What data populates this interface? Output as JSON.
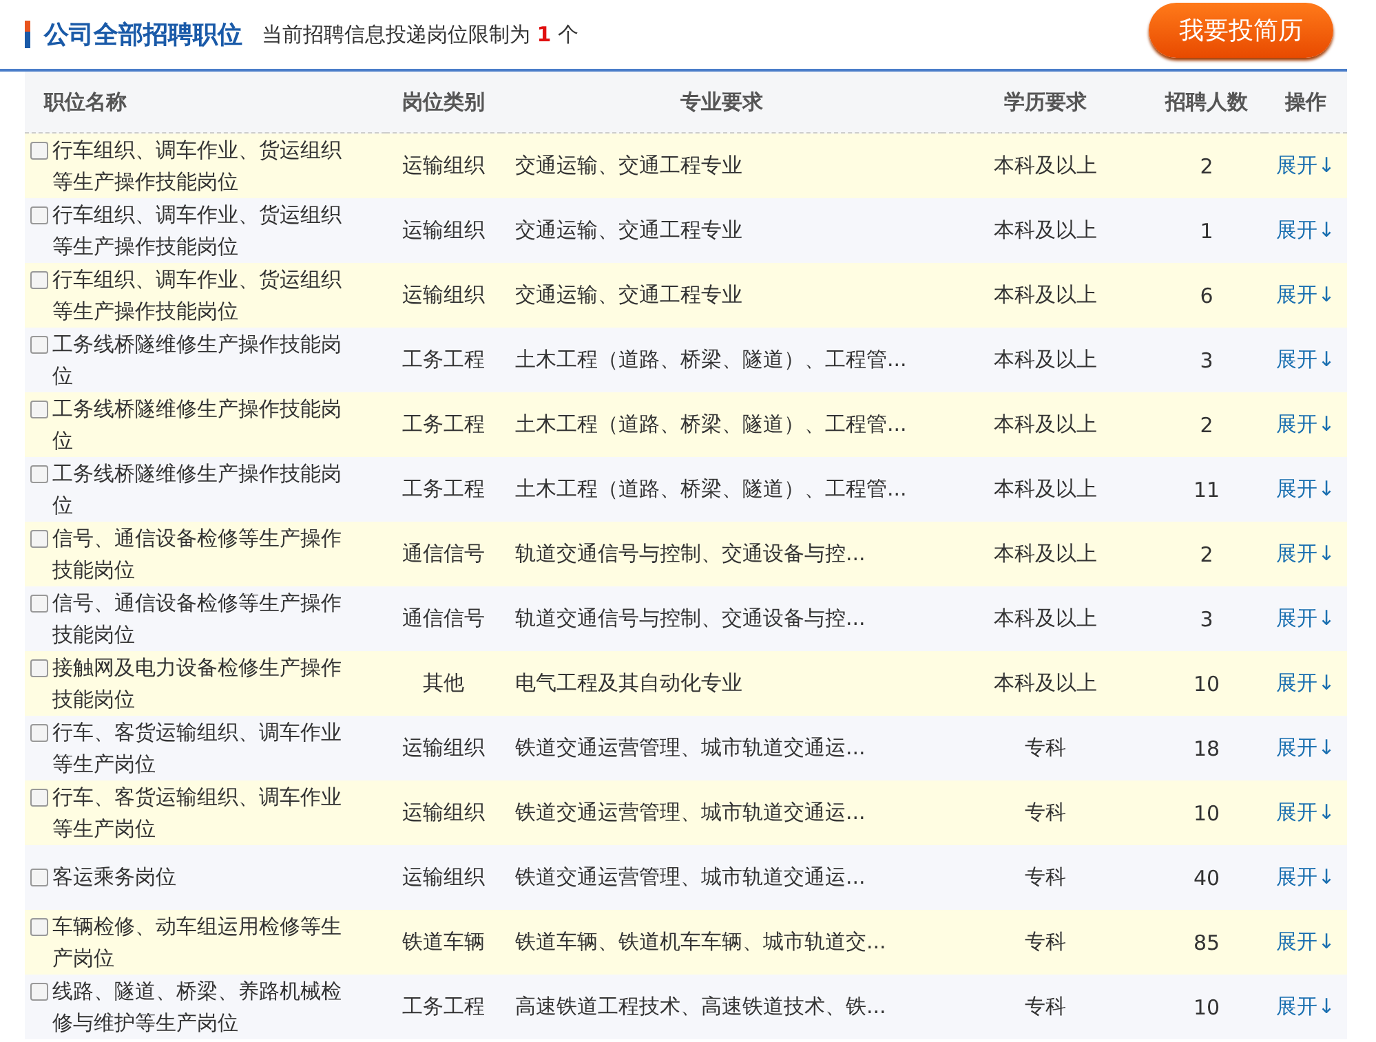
{
  "header": {
    "title": "公司全部招聘职位",
    "limit_text": "当前招聘信息投递岗位限制为",
    "limit_value": "1",
    "limit_unit": "个",
    "apply_button": "我要投简历"
  },
  "table": {
    "columns": [
      "职位名称",
      "岗位类别",
      "专业要求",
      "学历要求",
      "招聘人数",
      "操作"
    ],
    "rows": [
      {
        "checked": false,
        "name": "行车组织、调车作业、货运组织等生产操作技能岗位",
        "category": "运输组织",
        "major": "交通运输、交通工程专业",
        "education": "本科及以上",
        "count": "2",
        "action": "展开↓"
      },
      {
        "checked": false,
        "name": "行车组织、调车作业、货运组织等生产操作技能岗位",
        "category": "运输组织",
        "major": "交通运输、交通工程专业",
        "education": "本科及以上",
        "count": "1",
        "action": "展开↓"
      },
      {
        "checked": false,
        "name": "行车组织、调车作业、货运组织等生产操作技能岗位",
        "category": "运输组织",
        "major": "交通运输、交通工程专业",
        "education": "本科及以上",
        "count": "6",
        "action": "展开↓"
      },
      {
        "checked": false,
        "name": "工务线桥隧维修生产操作技能岗位",
        "category": "工务工程",
        "major": "土木工程（道路、桥梁、隧道）、工程管...",
        "education": "本科及以上",
        "count": "3",
        "action": "展开↓"
      },
      {
        "checked": false,
        "name": "工务线桥隧维修生产操作技能岗位",
        "category": "工务工程",
        "major": "土木工程（道路、桥梁、隧道）、工程管...",
        "education": "本科及以上",
        "count": "2",
        "action": "展开↓"
      },
      {
        "checked": false,
        "name": "工务线桥隧维修生产操作技能岗位",
        "category": "工务工程",
        "major": "土木工程（道路、桥梁、隧道）、工程管...",
        "education": "本科及以上",
        "count": "11",
        "action": "展开↓"
      },
      {
        "checked": false,
        "name": "信号、通信设备检修等生产操作技能岗位",
        "category": "通信信号",
        "major": "轨道交通信号与控制、交通设备与控...",
        "education": "本科及以上",
        "count": "2",
        "action": "展开↓"
      },
      {
        "checked": false,
        "name": "信号、通信设备检修等生产操作技能岗位",
        "category": "通信信号",
        "major": "轨道交通信号与控制、交通设备与控...",
        "education": "本科及以上",
        "count": "3",
        "action": "展开↓"
      },
      {
        "checked": false,
        "name": "接触网及电力设备检修生产操作技能岗位",
        "category": "其他",
        "major": "电气工程及其自动化专业",
        "education": "本科及以上",
        "count": "10",
        "action": "展开↓"
      },
      {
        "checked": false,
        "name": "行车、客货运输组织、调车作业等生产岗位",
        "category": "运输组织",
        "major": "铁道交通运营管理、城市轨道交通运...",
        "education": "专科",
        "count": "18",
        "action": "展开↓"
      },
      {
        "checked": false,
        "name": "行车、客货运输组织、调车作业等生产岗位",
        "category": "运输组织",
        "major": "铁道交通运营管理、城市轨道交通运...",
        "education": "专科",
        "count": "10",
        "action": "展开↓"
      },
      {
        "checked": false,
        "name": "客运乘务岗位",
        "category": "运输组织",
        "major": "铁道交通运营管理、城市轨道交通运...",
        "education": "专科",
        "count": "40",
        "action": "展开↓"
      },
      {
        "checked": false,
        "name": "车辆检修、动车组运用检修等生产岗位",
        "category": "铁道车辆",
        "major": "铁道车辆、铁道机车车辆、城市轨道交...",
        "education": "专科",
        "count": "85",
        "action": "展开↓"
      },
      {
        "checked": false,
        "name": "线路、隧道、桥梁、养路机械检修与维护等生产岗位",
        "category": "工务工程",
        "major": "高速铁道工程技术、高速铁道技术、铁...",
        "education": "专科",
        "count": "10",
        "action": "展开↓"
      }
    ]
  }
}
